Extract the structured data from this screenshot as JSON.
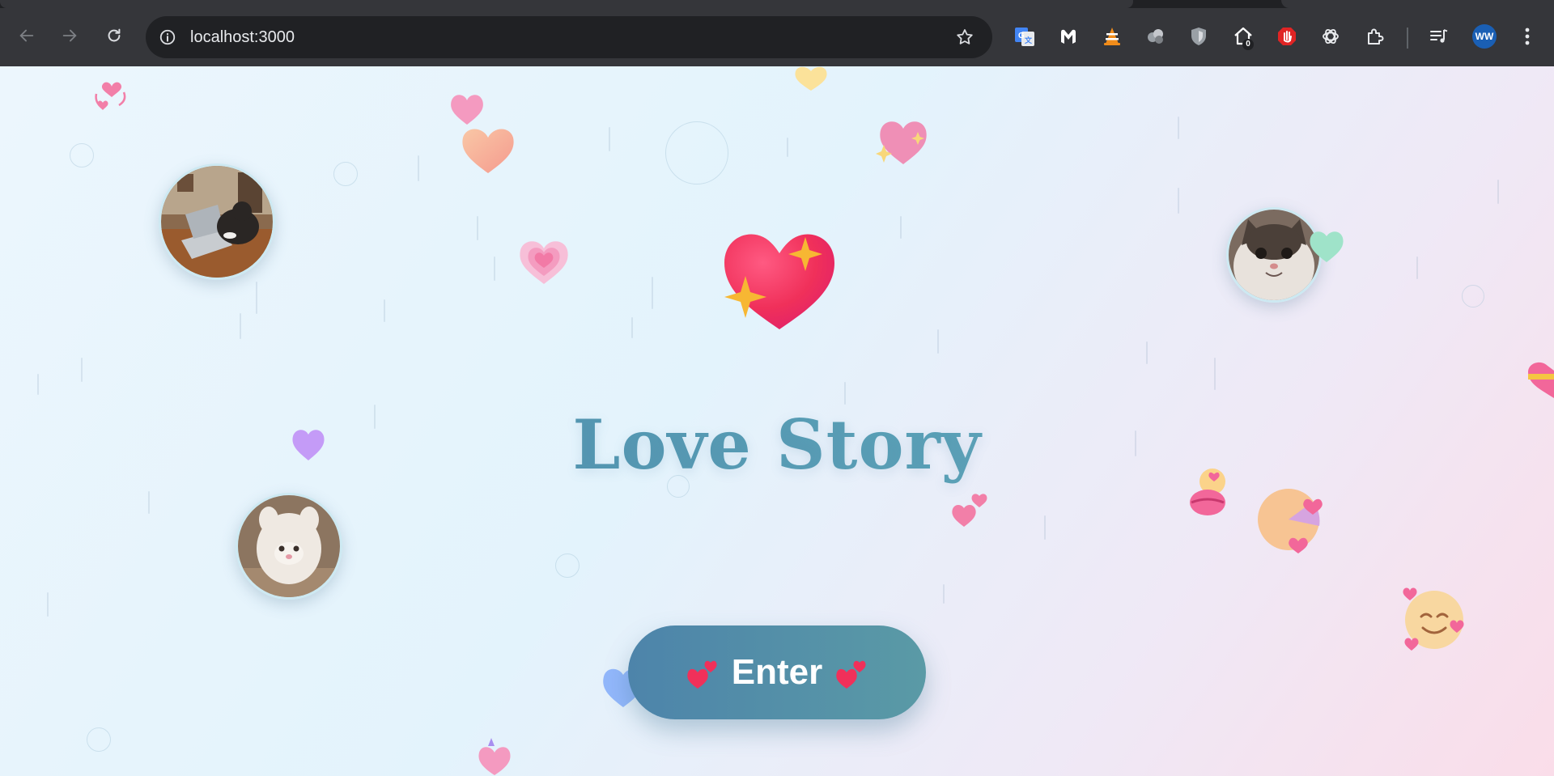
{
  "browser": {
    "url": "localhost:3000",
    "extension_badge_count": "0",
    "profile_initials": "WW"
  },
  "page": {
    "title": "Love Story",
    "enter_button_label": "Enter"
  },
  "colors": {
    "title_gradient_start": "#4a87a9",
    "button_gradient_start": "#4d84aa",
    "button_gradient_end": "#5a9aa6",
    "heart_red": "#f0305a",
    "sparkle_gold": "#f7b733"
  }
}
